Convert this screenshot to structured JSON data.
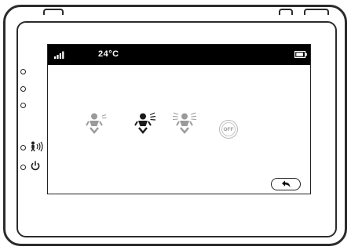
{
  "status_bar": {
    "signal_icon": "signal-bars-icon",
    "temperature": "24°C",
    "battery_icon": "battery-icon"
  },
  "side_panel": {
    "indicator_leds": [
      "led-1",
      "led-2",
      "led-3"
    ],
    "vox_icon": "vox-sound-icon",
    "power_icon": "power-icon"
  },
  "vibration_modes": [
    {
      "name": "vibration-low",
      "icon": "baby-vibration-low-icon",
      "state": "inactive"
    },
    {
      "name": "vibration-medium",
      "icon": "baby-vibration-medium-icon",
      "state": "selected"
    },
    {
      "name": "vibration-high",
      "icon": "baby-vibration-high-icon",
      "state": "inactive"
    }
  ],
  "off_button": {
    "label": "OFF"
  },
  "back_button": {
    "icon": "back-arrow-icon"
  },
  "colors": {
    "status_bar_bg": "#000000",
    "selected_icon": "#1a1a1a",
    "inactive_icon": "#9a9a9a",
    "frame": "#2b2b2b"
  }
}
